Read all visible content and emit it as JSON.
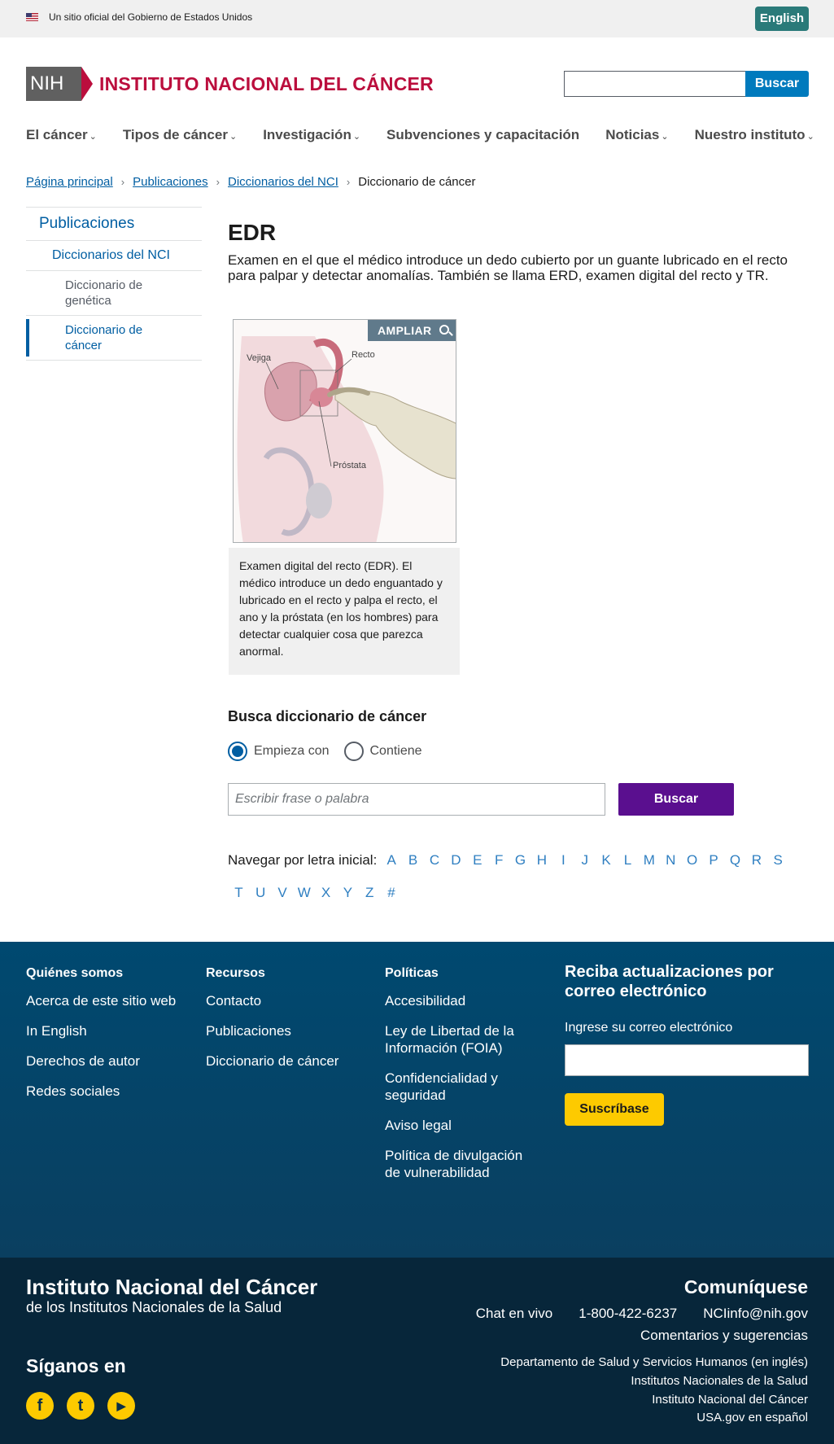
{
  "gov_banner": {
    "text": "Un sitio oficial del Gobierno de Estados Unidos",
    "language_button": "English"
  },
  "header": {
    "nih_label": "NIH",
    "site_title": "INSTITUTO NACIONAL DEL CÁNCER",
    "search_placeholder": "",
    "search_button": "Buscar"
  },
  "nav": {
    "items": [
      {
        "label": "El cáncer",
        "has_dropdown": true
      },
      {
        "label": "Tipos de cáncer",
        "has_dropdown": true
      },
      {
        "label": "Investigación",
        "has_dropdown": true
      },
      {
        "label": "Subvenciones y capacitación",
        "has_dropdown": false
      },
      {
        "label": "Noticias",
        "has_dropdown": true
      },
      {
        "label": "Nuestro instituto",
        "has_dropdown": true
      }
    ],
    "chevron": "⌄"
  },
  "breadcrumb": {
    "links": [
      "Página principal",
      "Publicaciones",
      "Diccionarios del NCI"
    ],
    "current": "Diccionario de cáncer",
    "separator": "›"
  },
  "sidebar": {
    "heading": "Publicaciones",
    "section": "Diccionarios del NCI",
    "items": [
      {
        "label": "Diccionario de genética",
        "active": false
      },
      {
        "label": "Diccionario de cáncer",
        "active": true
      }
    ]
  },
  "term": {
    "title": "EDR",
    "definition": "Examen en el que el médico introduce un dedo cubierto por un guante lubricado en el recto para palpar y detectar anomalías. También se llama ERD, examen digital del recto y TR."
  },
  "figure": {
    "enlarge_label": "AMPLIAR",
    "labels": {
      "bladder": "Vejiga",
      "rectum": "Recto",
      "prostate": "Próstata"
    },
    "caption": "Examen digital del recto (EDR). El médico introduce un dedo enguantado y lubricado en el recto y palpa el recto, el ano y la próstata (en los hombres) para detectar cualquier cosa que parezca anormal."
  },
  "dictionary_search": {
    "title": "Busca diccionario de cáncer",
    "options": [
      {
        "label": "Empieza con",
        "checked": true
      },
      {
        "label": "Contiene",
        "checked": false
      }
    ],
    "placeholder": "Escribir frase o palabra",
    "button": "Buscar"
  },
  "alphabet": {
    "label": "Navegar por letra inicial:",
    "row1": [
      "A",
      "B",
      "C",
      "D",
      "E",
      "F",
      "G",
      "H",
      "I",
      "J",
      "K",
      "L",
      "M",
      "N",
      "O",
      "P",
      "Q",
      "R",
      "S"
    ],
    "row2": [
      "T",
      "U",
      "V",
      "W",
      "X",
      "Y",
      "Z",
      "#"
    ]
  },
  "footer": {
    "columns": [
      {
        "heading": "Quiénes somos",
        "links": [
          "Acerca de este sitio web",
          "In English",
          "Derechos de autor",
          "Redes sociales"
        ]
      },
      {
        "heading": "Recursos",
        "links": [
          "Contacto",
          "Publicaciones",
          "Diccionario de cáncer"
        ]
      },
      {
        "heading": "Políticas",
        "links": [
          "Accesibilidad",
          "Ley de Libertad de la Información (FOIA)",
          "Confidencialidad y seguridad",
          "Aviso legal",
          "Política de divulgación de vulnerabilidad"
        ]
      }
    ],
    "subscribe": {
      "title": "Reciba actualizaciones por correo electrónico",
      "label": "Ingrese su correo electrónico",
      "button": "Suscríbase"
    },
    "org_name": "Instituto Nacional del Cáncer",
    "org_sub": "de los Institutos Nacionales de la Salud",
    "follow": "Síganos en",
    "social": [
      {
        "icon": "facebook-icon",
        "glyph": "f"
      },
      {
        "icon": "twitter-icon",
        "glyph": "t"
      },
      {
        "icon": "youtube-icon",
        "glyph": "▶"
      }
    ],
    "contact_title": "Comuníquese",
    "chat": "Chat en vivo",
    "phone": "1-800-422-6237",
    "email": "NCIinfo@nih.gov",
    "feedback": "Comentarios y sugerencias",
    "agency_links": [
      "Departamento de Salud y Servicios Humanos (en inglés)",
      "Institutos Nacionales de la Salud",
      "Instituto Nacional del Cáncer",
      "USA.gov en español"
    ]
  },
  "colors": {
    "nci_red": "#bb0e3d",
    "link_blue": "#005ea2",
    "search_purple": "#5a0f8f",
    "footer_blue": "#004970",
    "footer_dark": "#07263a",
    "accent_yellow": "#fdca00"
  }
}
